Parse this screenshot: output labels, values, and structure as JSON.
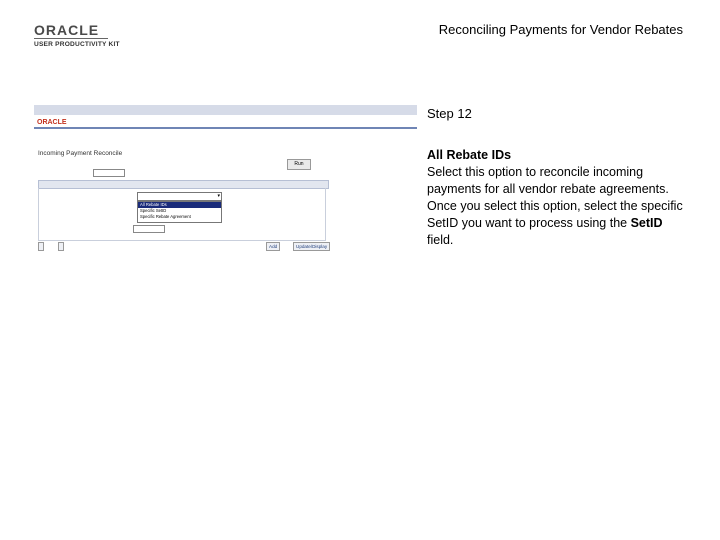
{
  "header": {
    "logo_brand": "ORACLE",
    "logo_subtitle": "USER PRODUCTIVITY KIT",
    "doc_title": "Reconciling Payments for Vendor Rebates"
  },
  "screenshot": {
    "oracle_logo": "ORACLE",
    "page_title": "Incoming Payment Reconcile",
    "run_button": "Run",
    "dropdown_options": [
      "All Rebate IDs",
      "Specific SetID",
      "Specific Rebate Agreement"
    ],
    "buttons": {
      "add": "Add",
      "update_display": "Update/Display"
    }
  },
  "instructions": {
    "step": "Step 12",
    "heading": "All Rebate IDs",
    "body_part1": "Select this option to reconcile incoming payments for all vendor rebate agreements. Once you select this option, select the specific ",
    "setid_inline": "SetID",
    "body_part2": " you want to process using the ",
    "setid_field": "SetID",
    "body_part3": " field."
  }
}
